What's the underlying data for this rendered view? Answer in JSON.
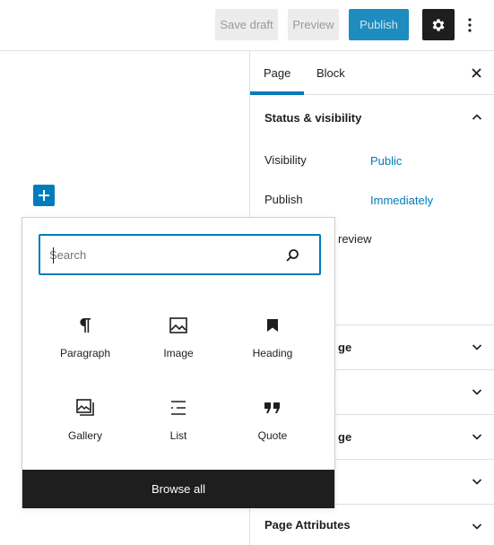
{
  "toolbar": {
    "save_draft_label": "Save draft",
    "preview_label": "Preview",
    "publish_label": "Publish",
    "settings_icon": "gear-icon",
    "more_icon": "vertical-ellipsis-icon"
  },
  "sidebar": {
    "tabs": [
      {
        "label": "Page",
        "active": true
      },
      {
        "label": "Block",
        "active": false
      }
    ],
    "close_icon": "close-icon",
    "status_visibility": {
      "title": "Status & visibility",
      "expanded": true,
      "rows": [
        {
          "label": "Visibility",
          "value": "Public"
        },
        {
          "label": "Publish",
          "value": "Immediately"
        }
      ],
      "partial_text": "review"
    },
    "collapsed_panels": [
      {
        "title_fragment": "ge"
      },
      {
        "title_fragment": ""
      },
      {
        "title_fragment": "ge"
      },
      {
        "title_fragment": ""
      },
      {
        "title_fragment": "Page Attributes"
      }
    ]
  },
  "canvas": {
    "add_block_icon": "plus-icon"
  },
  "inserter": {
    "search_placeholder": "Search",
    "blocks": [
      {
        "label": "Paragraph",
        "icon": "paragraph-icon"
      },
      {
        "label": "Image",
        "icon": "image-icon"
      },
      {
        "label": "Heading",
        "icon": "bookmark-icon"
      },
      {
        "label": "Gallery",
        "icon": "gallery-icon"
      },
      {
        "label": "List",
        "icon": "list-icon"
      },
      {
        "label": "Quote",
        "icon": "quote-icon"
      }
    ],
    "browse_all_label": "Browse all"
  },
  "colors": {
    "accent": "#007cba",
    "publish_bg": "#1e8cbe",
    "dark": "#1e1e1e",
    "disabled_bg": "#ececec"
  }
}
